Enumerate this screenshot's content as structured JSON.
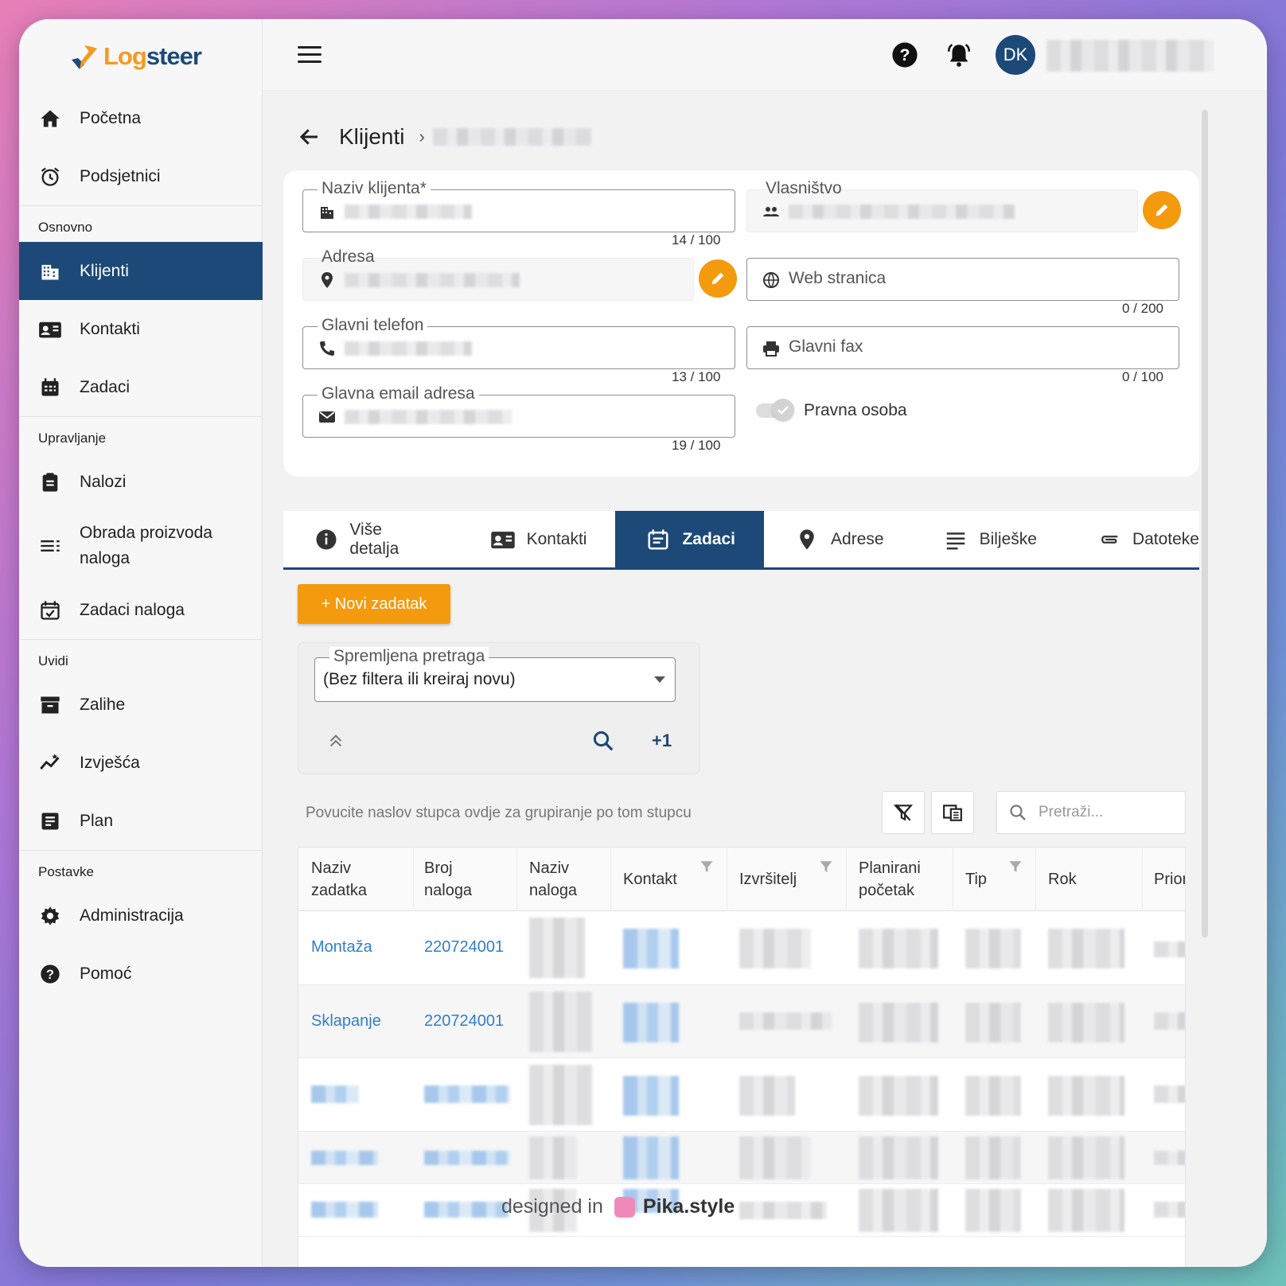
{
  "app": {
    "logo_part1": "Log",
    "logo_part2": "steer"
  },
  "sidebar": {
    "items": [
      {
        "label": "Početna"
      },
      {
        "label": "Podsjetnici"
      }
    ],
    "sections": [
      {
        "title": "Osnovno",
        "items": [
          {
            "label": "Klijenti"
          },
          {
            "label": "Kontakti"
          },
          {
            "label": "Zadaci"
          }
        ]
      },
      {
        "title": "Upravljanje",
        "items": [
          {
            "label": "Nalozi"
          },
          {
            "label": "Obrada proizvoda naloga"
          },
          {
            "label": "Zadaci naloga"
          }
        ]
      },
      {
        "title": "Uvidi",
        "items": [
          {
            "label": "Zalihe"
          },
          {
            "label": "Izvješća"
          },
          {
            "label": "Plan"
          }
        ]
      },
      {
        "title": "Postavke",
        "items": [
          {
            "label": "Administracija"
          },
          {
            "label": "Pomoć"
          }
        ]
      }
    ],
    "active": "Klijenti"
  },
  "topbar": {
    "avatar_initials": "DK"
  },
  "breadcrumb": {
    "root": "Klijenti"
  },
  "form": {
    "client_name": {
      "label": "Naziv klijenta*",
      "counter": "14 / 100"
    },
    "ownership": {
      "label": "Vlasništvo"
    },
    "address": {
      "label": "Adresa"
    },
    "website": {
      "placeholder": "Web stranica",
      "counter": "0 / 200"
    },
    "phone": {
      "label": "Glavni telefon",
      "counter": "13 / 100"
    },
    "fax": {
      "placeholder": "Glavni fax",
      "counter": "0 / 100"
    },
    "email": {
      "label": "Glavna email adresa",
      "counter": "19 / 100"
    },
    "legal_entity": {
      "label": "Pravna osoba"
    }
  },
  "tabs": [
    {
      "label": "Više detalja",
      "icon": "info-icon"
    },
    {
      "label": "Kontakti",
      "icon": "contact-card-icon"
    },
    {
      "label": "Zadaci",
      "icon": "calendar-icon",
      "active": true
    },
    {
      "label": "Adrese",
      "icon": "pin-icon"
    },
    {
      "label": "Bilješke",
      "icon": "notes-icon"
    },
    {
      "label": "Datoteke",
      "icon": "paperclip-icon"
    }
  ],
  "tasks": {
    "new_button": "+ Novi zadatak",
    "saved_search": {
      "label": "Spremljena pretraga",
      "value": "(Bez filtera ili kreiraj novu)"
    },
    "extra_filters": "+1",
    "group_hint": "Povucite naslov stupca ovdje za grupiranje po tom stupcu",
    "search_placeholder": "Pretraži...",
    "columns": [
      "Naziv zadatka",
      "Broj naloga",
      "Naziv naloga",
      "Kontakt",
      "Izvršitelj",
      "Planirani početak",
      "Tip",
      "Rok",
      "Prior"
    ],
    "rows": [
      {
        "task": "Montaža",
        "order": "220724001"
      },
      {
        "task": "Sklapanje",
        "order": "220724001"
      }
    ]
  },
  "watermark": {
    "prefix": "designed in",
    "brand": "Pika.style"
  },
  "colors": {
    "primary": "#1c4977",
    "accent": "#f39a0e",
    "link": "#2f7fcb"
  }
}
